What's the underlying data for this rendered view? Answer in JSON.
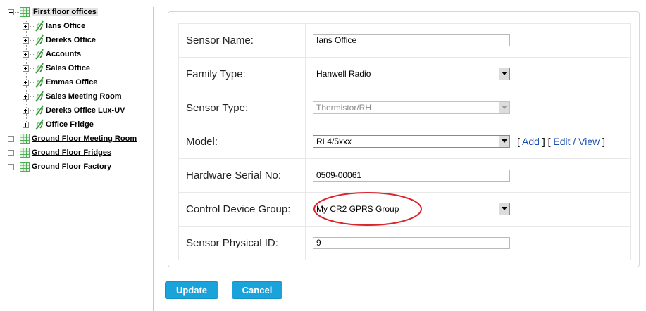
{
  "tree": {
    "root": {
      "label": "First floor offices",
      "icon": "grid-icon"
    },
    "children": [
      {
        "label": "Ians Office",
        "icon": "sensor-icon"
      },
      {
        "label": "Dereks Office",
        "icon": "sensor-icon"
      },
      {
        "label": "Accounts",
        "icon": "sensor-icon"
      },
      {
        "label": "Sales Office",
        "icon": "sensor-icon"
      },
      {
        "label": "Emmas Office",
        "icon": "sensor-icon"
      },
      {
        "label": "Sales Meeting Room",
        "icon": "sensor-icon"
      },
      {
        "label": "Dereks Office Lux-UV",
        "icon": "sensor-icon"
      },
      {
        "label": "Office Fridge",
        "icon": "sensor-icon"
      }
    ],
    "siblings": [
      {
        "label": "Ground Floor Meeting Room",
        "icon": "grid-icon"
      },
      {
        "label": "Ground Floor Fridges",
        "icon": "grid-icon"
      },
      {
        "label": "Ground Floor Factory",
        "icon": "grid-icon"
      }
    ]
  },
  "form": {
    "sensor_name": {
      "label": "Sensor Name:",
      "value": "Ians Office"
    },
    "family_type": {
      "label": "Family Type:",
      "value": "Hanwell Radio"
    },
    "sensor_type": {
      "label": "Sensor Type:",
      "value": "Thermistor/RH"
    },
    "model": {
      "label": "Model:",
      "value": "RL4/5xxx",
      "bracket_open_1": "[",
      "add_link": "Add",
      "bracket_close_1": "]",
      "bracket_open_2": "[",
      "edit_link": "Edit / View",
      "bracket_close_2": "]"
    },
    "hardware_serial": {
      "label": "Hardware Serial No:",
      "value": "0509-00061"
    },
    "control_device_group": {
      "label": "Control Device Group:",
      "value": "My CR2 GPRS Group"
    },
    "sensor_physical_id": {
      "label": "Sensor Physical ID:",
      "value": "9"
    }
  },
  "buttons": {
    "update": "Update",
    "cancel": "Cancel"
  },
  "colors": {
    "button_bg": "#1aa3db",
    "link": "#1a4fb0",
    "highlight_ellipse": "#d9262c",
    "grid_icon": "#4caf50",
    "sensor_icon": "#3a9b3a"
  }
}
